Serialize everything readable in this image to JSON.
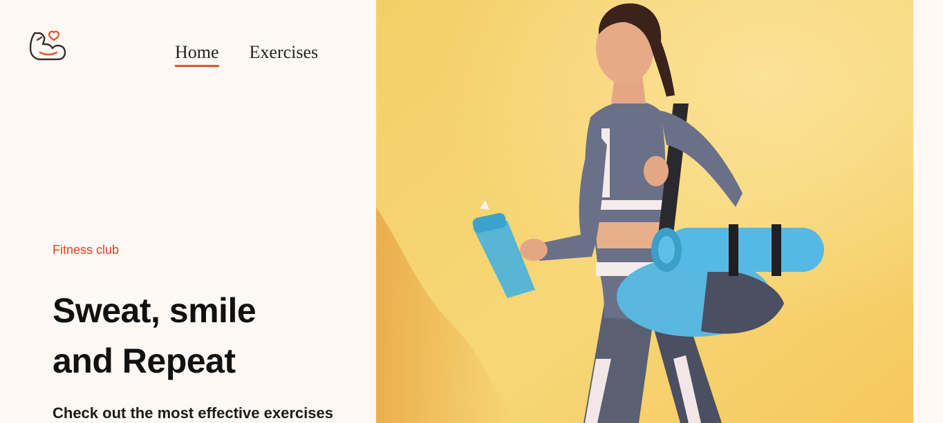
{
  "nav": {
    "items": [
      {
        "label": "Home",
        "active": true
      },
      {
        "label": "Exercises",
        "active": false
      }
    ]
  },
  "logo": {
    "icon": "flexed-arm-heart-icon",
    "accent": "#e8532a"
  },
  "hero": {
    "eyebrow": "Fitness club",
    "title_line1": "Sweat, smile",
    "title_line2": "and Repeat",
    "subtitle": "Check out the most effective exercises"
  },
  "banner": {
    "image": "woman-with-shaker-and-yoga-mat",
    "background_color": "#f6cd64"
  },
  "colors": {
    "accent": "#e8532a",
    "page_background": "#fff9f6",
    "text": "#111111"
  }
}
